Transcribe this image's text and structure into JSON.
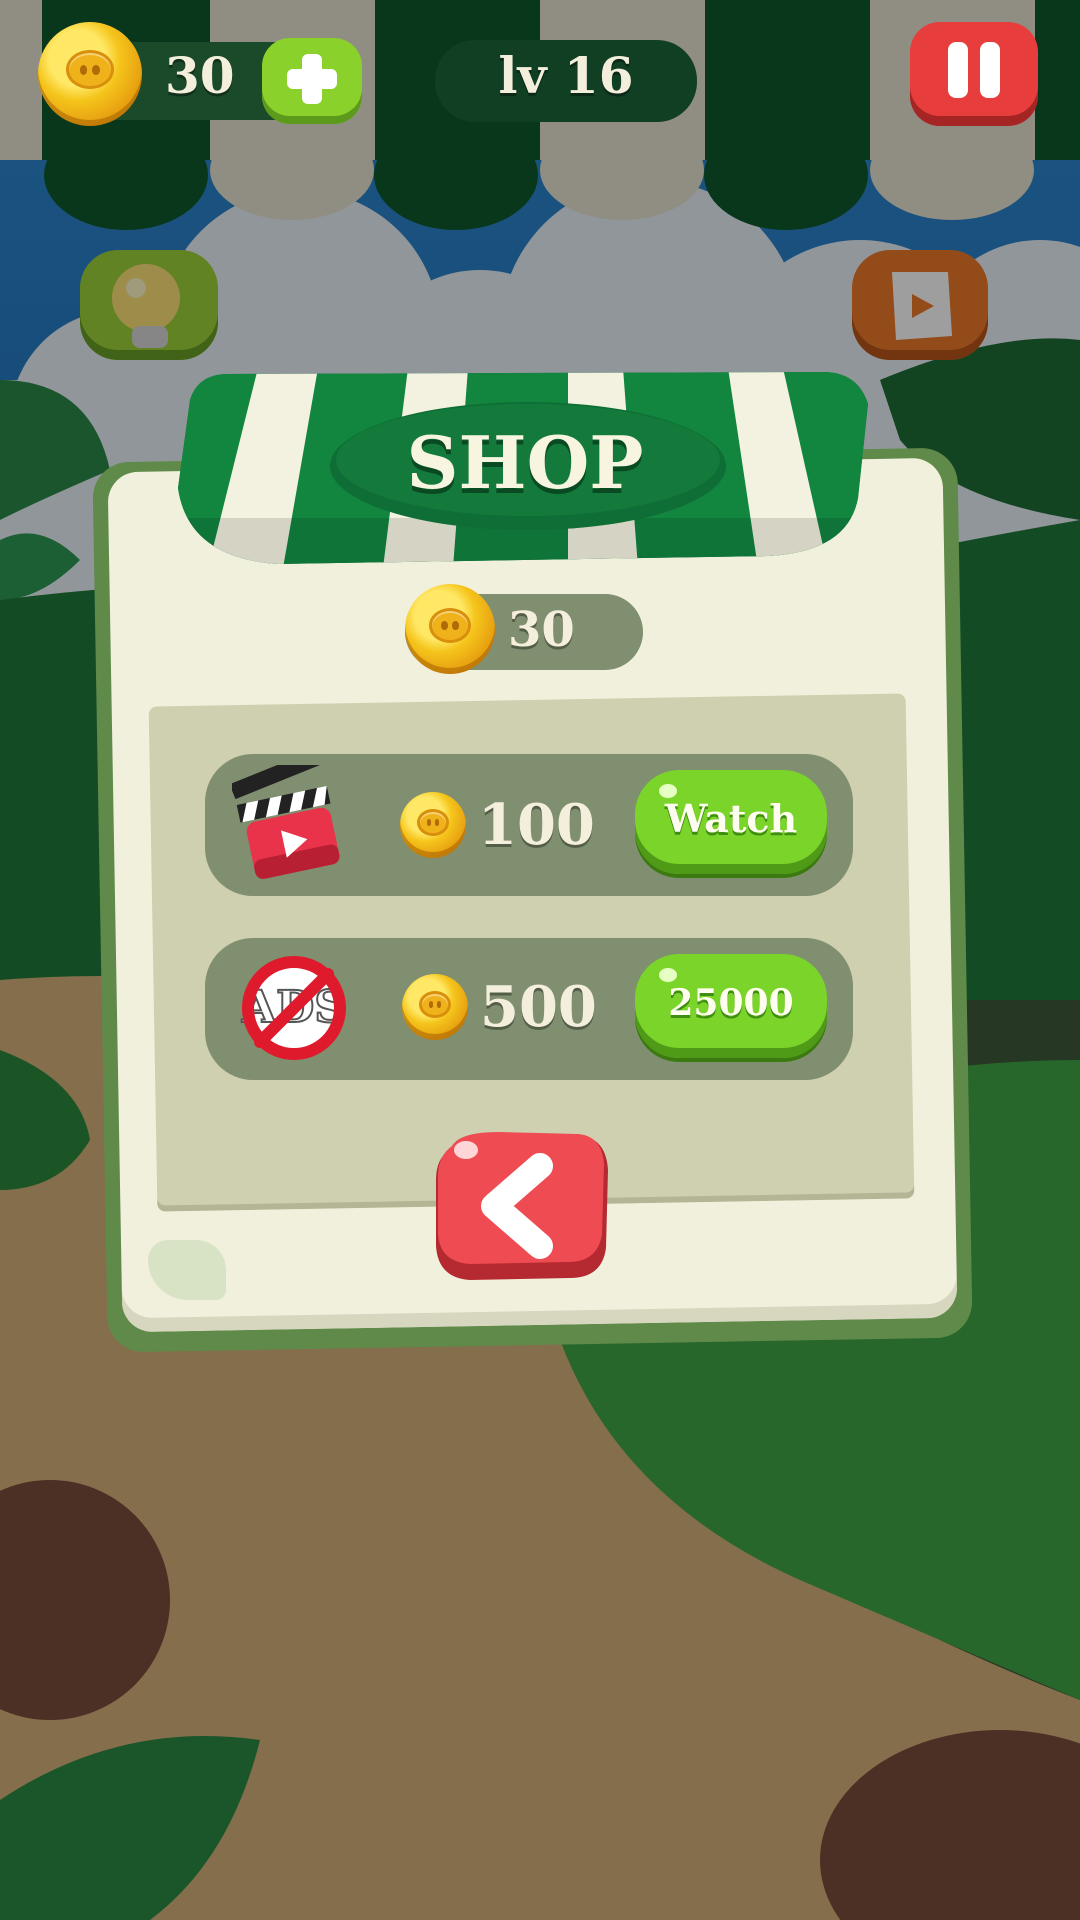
{
  "hud": {
    "coins": "30",
    "level": "lv 16"
  },
  "shop": {
    "title": "SHOP",
    "balance": "30",
    "items": [
      {
        "icon": "clapperboard-icon",
        "price": "100",
        "button": "Watch"
      },
      {
        "icon": "no-ads-icon",
        "price": "500",
        "button": "25000"
      }
    ]
  },
  "colors": {
    "awning_green": "#12853f",
    "awning_white": "#f3f2e0",
    "button_green": "#7bd42a",
    "button_red": "#e8444a",
    "panel_cream": "#f1f0dc"
  }
}
